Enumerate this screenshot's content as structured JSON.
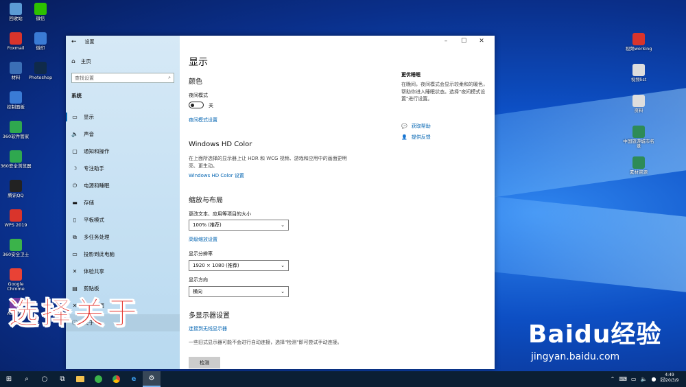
{
  "desktop": {
    "left_icons": [
      {
        "label": "回收站",
        "icon": "recycle-bin-icon",
        "color": "#5b9bd5"
      },
      {
        "label": "Foxmail",
        "icon": "foxmail-icon",
        "color": "#d9342b"
      },
      {
        "label": "材料",
        "icon": "document-icon",
        "color": "#3b6fb6"
      },
      {
        "label": "控制面板",
        "icon": "control-panel-icon",
        "color": "#3a7bd5"
      },
      {
        "label": "360软件管家",
        "icon": "360-manager-icon",
        "color": "#2fa84f"
      },
      {
        "label": "360安全浏览器",
        "icon": "360-browser-icon",
        "color": "#2fa84f"
      },
      {
        "label": "腾讯QQ",
        "icon": "qq-icon",
        "color": "#222222"
      },
      {
        "label": "WPS 2019",
        "icon": "wps-icon",
        "color": "#d9342b"
      },
      {
        "label": "360安全卫士",
        "icon": "360-guard-icon",
        "color": "#3bb34a"
      },
      {
        "label": "Google Chrome",
        "icon": "chrome-icon",
        "color": "#e94235"
      },
      {
        "label": "ASK Pro",
        "icon": "app-icon",
        "color": "#7a3ea1"
      }
    ],
    "second_icons": [
      {
        "label": "微信",
        "icon": "wechat-icon",
        "color": "#2dc100"
      },
      {
        "label": "微印",
        "icon": "app-icon",
        "color": "#3a7bd5"
      },
      {
        "label": "Photoshop",
        "icon": "photoshop-icon",
        "color": "#0f2a4a"
      }
    ],
    "right_icons": [
      {
        "label": "视频working",
        "icon": "document-icon",
        "color": "#d9342b"
      },
      {
        "label": "视频list",
        "icon": "document-icon",
        "color": "#dddddd"
      },
      {
        "label": "资料",
        "icon": "document-icon",
        "color": "#dddddd"
      },
      {
        "label": "中国旅游城市名录",
        "icon": "excel-icon",
        "color": "#2e8b57"
      },
      {
        "label": "素材资源",
        "icon": "excel-icon",
        "color": "#2e8b57"
      }
    ]
  },
  "settings": {
    "title": "设置",
    "home": "主页",
    "search_placeholder": "查找设置",
    "section": "系统",
    "nav": [
      {
        "label": "显示",
        "icon": "monitor-icon",
        "glyph": "▭"
      },
      {
        "label": "声音",
        "icon": "speaker-icon",
        "glyph": "🔈"
      },
      {
        "label": "通知和操作",
        "icon": "notification-icon",
        "glyph": "▢"
      },
      {
        "label": "专注助手",
        "icon": "moon-icon",
        "glyph": "☽"
      },
      {
        "label": "电源和睡眠",
        "icon": "power-icon",
        "glyph": "⏻"
      },
      {
        "label": "存储",
        "icon": "storage-icon",
        "glyph": "▬"
      },
      {
        "label": "平板模式",
        "icon": "tablet-icon",
        "glyph": "▯"
      },
      {
        "label": "多任务处理",
        "icon": "multitask-icon",
        "glyph": "⧉"
      },
      {
        "label": "投影到此电脑",
        "icon": "project-icon",
        "glyph": "▭"
      },
      {
        "label": "体验共享",
        "icon": "share-icon",
        "glyph": "✕"
      },
      {
        "label": "剪贴板",
        "icon": "clipboard-icon",
        "glyph": "▤"
      },
      {
        "label": "远程桌面",
        "icon": "remote-icon",
        "glyph": "✕"
      },
      {
        "label": "关于",
        "icon": "info-icon",
        "glyph": "ⓘ"
      }
    ],
    "page_title": "显示",
    "color_heading": "颜色",
    "night_mode_label": "夜间模式",
    "night_mode_state": "关",
    "night_mode_link": "夜间模式设置",
    "hdr_heading": "Windows HD Color",
    "hdr_desc": "在上面所选择的显示器上让 HDR 和 WCG 视频、游戏和应用中的画面更明亮、更生动。",
    "hdr_link": "Windows HD Color 设置",
    "scale_heading": "缩放与布局",
    "scale_label": "更改文本、应用等项目的大小",
    "scale_value": "100% (推荐)",
    "advanced_scale_link": "高级缩放设置",
    "resolution_label": "显示分辨率",
    "resolution_value": "1920 × 1080 (推荐)",
    "orientation_label": "显示方向",
    "orientation_value": "横向",
    "multi_heading": "多显示器设置",
    "wireless_link": "连接到无线显示器",
    "multi_desc": "一些旧式显示器可能不会进行自动连接，选择\"检测\"即可尝试手动连接。",
    "detect_button": "检测",
    "side_heading": "更优睡眠",
    "side_desc": "在晚间，夜间模式会显示较柔和的暖色，帮助你进入睡眠状态。选择\"夜间模式设置\"进行设置。",
    "help_link": "获取帮助",
    "feedback_link": "提供反馈"
  },
  "overlay_caption": "选择关于",
  "watermark": {
    "logo": "Baidu经验",
    "url": "jingyan.baidu.com"
  },
  "taskbar": {
    "time": "4:49",
    "date": "2020/3/9",
    "icons": [
      "start-icon",
      "search-icon",
      "cortana-icon",
      "task-view-icon",
      "explorer-icon",
      "360-browser-icon",
      "chrome-icon",
      "edge-icon",
      "settings-icon"
    ]
  },
  "colors": {
    "accent": "#0063b1",
    "overlay": "#e2302a",
    "taskbar": "#0b1f34"
  }
}
